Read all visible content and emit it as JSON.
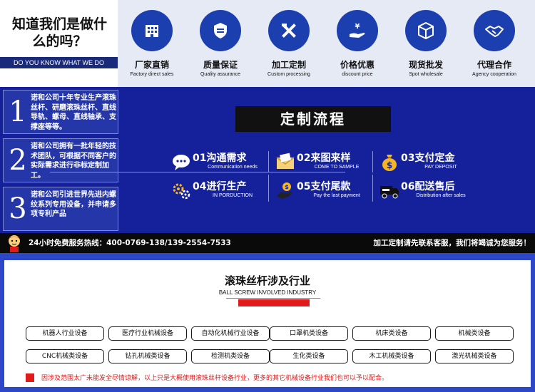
{
  "intro": {
    "title_line1": "知道我们是做什",
    "title_line2": "么的吗？",
    "subtitle_en": "DO YOU KNOW WHAT WE DO"
  },
  "features": [
    {
      "zh": "厂家直销",
      "en": "Factory direct sales",
      "icon": "factory-icon"
    },
    {
      "zh": "质量保证",
      "en": "Quality assurance",
      "icon": "shield-icon"
    },
    {
      "zh": "加工定制",
      "en": "Custom processing",
      "icon": "tools-icon"
    },
    {
      "zh": "价格优惠",
      "en": "discount price",
      "icon": "yen-hand-icon"
    },
    {
      "zh": "现货批发",
      "en": "Spot wholesale",
      "icon": "box-icon"
    },
    {
      "zh": "代理合作",
      "en": "Agency cooperation",
      "icon": "handshake-icon"
    }
  ],
  "advantages": [
    {
      "num": "1",
      "text": "诺和公司十年专业生产滚珠丝杆、研磨滚珠丝杆、直线导轨、螺母、直线轴承、支撑座等等。"
    },
    {
      "num": "2",
      "text": "诺和公司拥有一批年轻的技术团队，可根据不同客户的实际需求进行非标定制加工。"
    },
    {
      "num": "3",
      "text": "诺和公司引进世界先进内螺纹系列专用设备，并申请多项专利产品"
    }
  ],
  "process": {
    "title": "定制流程",
    "steps": [
      {
        "zh": "01沟通需求",
        "en": "Communication needs",
        "icon": "chat-icon"
      },
      {
        "zh": "02来图来样",
        "en": "COME TO SAMPLE",
        "icon": "envelope-icon"
      },
      {
        "zh": "03支付定金",
        "en": "PAY DEPOSIT",
        "icon": "money-bag-icon"
      },
      {
        "zh": "04进行生产",
        "en": "IN PORDUCTION",
        "icon": "gears-icon"
      },
      {
        "zh": "05支付尾款",
        "en": "Pay the last payment",
        "icon": "coin-hand-icon"
      },
      {
        "zh": "06配送售后",
        "en": "Distribution after sales",
        "icon": "delivery-truck-icon"
      }
    ]
  },
  "hotline": {
    "left": "24小时免费服务热线：400-0769-138/139-2554-7533",
    "right": "加工定制请先联系客服，我们将竭诚为您服务！"
  },
  "industry": {
    "title": "滚珠丝杆涉及行业",
    "subtitle_en": "BALL SCREW INVOLVED INDUSTRY",
    "tags": [
      "机器人行业设备",
      "医疗行业机械设备",
      "自动化机械行业设备",
      "口罩机类设备",
      "机床类设备",
      "机械类设备",
      "CNC机械类设备",
      "钻孔机械类设备",
      "检测机类设备",
      "生化类设备",
      "木工机械类设备",
      "激光机械类设备"
    ],
    "note": "因涉及范围太广未能发全尽情谅解，以上只是大概使用滚珠丝杆设备行业，更多的其它机械设备行业我们也可以予以配合。"
  },
  "colors": {
    "primary_blue": "#1c3fb0",
    "dark_blue": "#14219a",
    "accent_red": "#e01b1b",
    "gold": "#f5b622"
  }
}
